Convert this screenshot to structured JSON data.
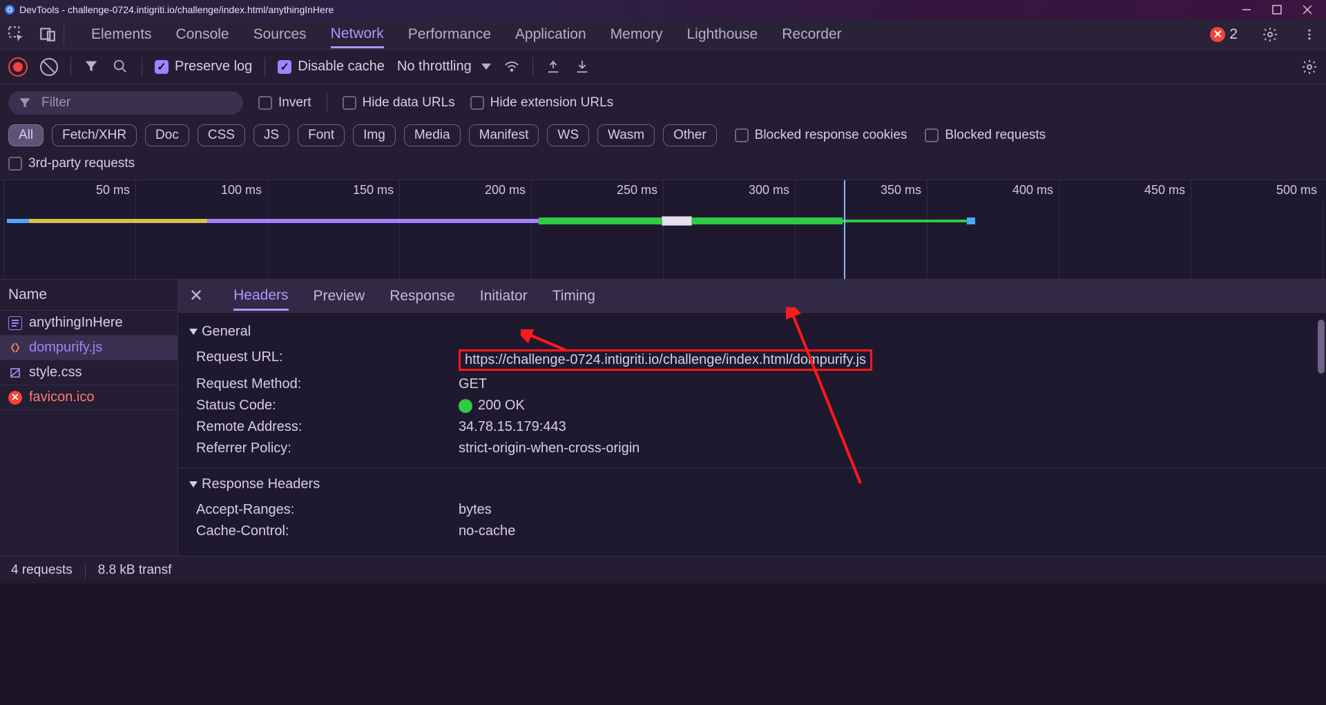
{
  "titlebar": {
    "prefix": "DevTools - ",
    "url": "challenge-0724.intigriti.io/challenge/index.html/anythingInHere"
  },
  "tabs": {
    "elements": "Elements",
    "console": "Console",
    "sources": "Sources",
    "network": "Network",
    "performance": "Performance",
    "application": "Application",
    "memory": "Memory",
    "lighthouse": "Lighthouse",
    "recorder": "Recorder",
    "error_count": "2"
  },
  "toolbar": {
    "preserve_log": "Preserve log",
    "disable_cache": "Disable cache",
    "throttling": "No throttling"
  },
  "filterbar": {
    "filter_placeholder": "Filter",
    "invert": "Invert",
    "hide_data": "Hide data URLs",
    "hide_ext": "Hide extension URLs",
    "blocked_cookies": "Blocked response cookies",
    "blocked_req": "Blocked requests",
    "third_party": "3rd-party requests",
    "types": [
      "All",
      "Fetch/XHR",
      "Doc",
      "CSS",
      "JS",
      "Font",
      "Img",
      "Media",
      "Manifest",
      "WS",
      "Wasm",
      "Other"
    ]
  },
  "timeline": {
    "ticks": [
      "50 ms",
      "100 ms",
      "150 ms",
      "200 ms",
      "250 ms",
      "300 ms",
      "350 ms",
      "400 ms",
      "450 ms",
      "500 ms"
    ]
  },
  "requests": {
    "name_header": "Name",
    "rows": [
      {
        "icon": "doc",
        "name": "anythingInHere"
      },
      {
        "icon": "js",
        "name": "dompurify.js"
      },
      {
        "icon": "css",
        "name": "style.css"
      },
      {
        "icon": "err",
        "name": "favicon.ico"
      }
    ]
  },
  "detail": {
    "tabs": {
      "headers": "Headers",
      "preview": "Preview",
      "response": "Response",
      "initiator": "Initiator",
      "timing": "Timing"
    },
    "general_title": "General",
    "general": [
      {
        "k": "Request URL:",
        "v": "https://challenge-0724.intigriti.io/challenge/index.html/dompurify.js",
        "red": true
      },
      {
        "k": "Request Method:",
        "v": "GET"
      },
      {
        "k": "Status Code:",
        "v": "200 OK",
        "dot": true
      },
      {
        "k": "Remote Address:",
        "v": "34.78.15.179:443"
      },
      {
        "k": "Referrer Policy:",
        "v": "strict-origin-when-cross-origin"
      }
    ],
    "resp_title": "Response Headers",
    "resp": [
      {
        "k": "Accept-Ranges:",
        "v": "bytes"
      },
      {
        "k": "Cache-Control:",
        "v": "no-cache"
      }
    ]
  },
  "status": {
    "requests": "4 requests",
    "transfer": "8.8 kB transf"
  }
}
